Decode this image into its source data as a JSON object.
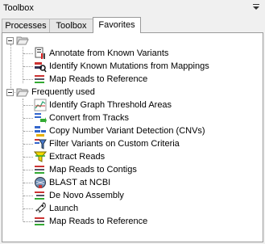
{
  "window": {
    "title": "Toolbox"
  },
  "tabs": [
    {
      "label": "Processes",
      "active": false
    },
    {
      "label": "Toolbox",
      "active": false
    },
    {
      "label": "Favorites",
      "active": true
    }
  ],
  "tree": {
    "groups": [
      {
        "label": "",
        "items": [
          {
            "label": "Annotate from Known Variants",
            "icon": "variant-annotate-icon"
          },
          {
            "label": "Identify Known Mutations from Mappings",
            "icon": "mutation-identify-icon"
          },
          {
            "label": "Map Reads to Reference",
            "icon": "map-reads-icon"
          }
        ]
      },
      {
        "label": "Frequently used",
        "items": [
          {
            "label": "Identify Graph Threshold Areas",
            "icon": "graph-threshold-icon"
          },
          {
            "label": "Convert from Tracks",
            "icon": "convert-tracks-icon"
          },
          {
            "label": "Copy Number Variant Detection (CNVs)",
            "icon": "cnv-detection-icon"
          },
          {
            "label": "Filter Variants on Custom Criteria",
            "icon": "filter-variants-icon"
          },
          {
            "label": "Extract Reads",
            "icon": "extract-reads-icon"
          },
          {
            "label": "Map Reads to Contigs",
            "icon": "map-contigs-icon"
          },
          {
            "label": "BLAST at NCBI",
            "icon": "blast-ncbi-icon"
          },
          {
            "label": "De Novo Assembly",
            "icon": "de-novo-assembly-icon"
          },
          {
            "label": "Launch",
            "icon": "launch-icon"
          },
          {
            "label": "Map Reads to Reference",
            "icon": "map-reads-icon"
          }
        ]
      }
    ]
  }
}
